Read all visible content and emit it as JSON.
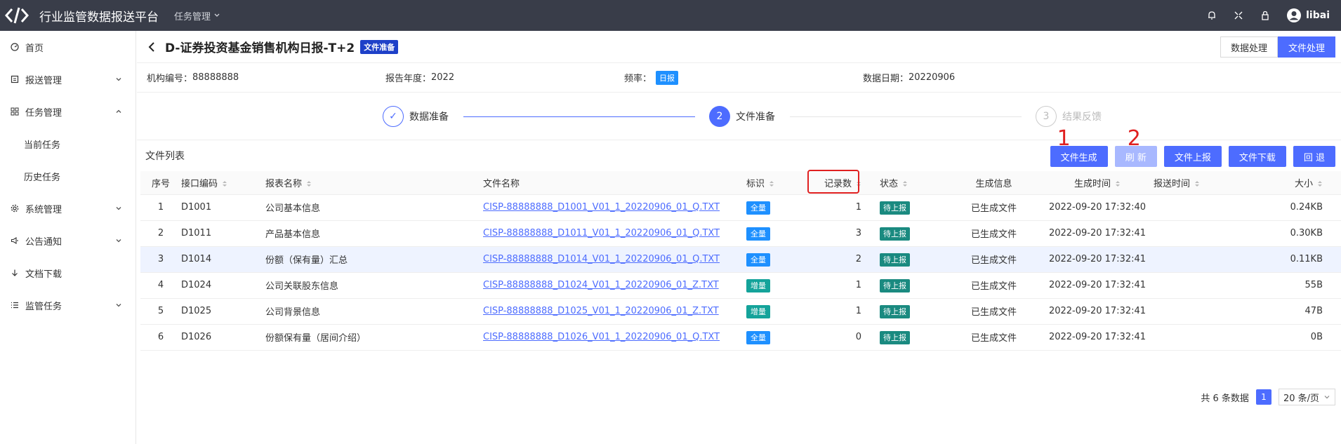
{
  "app": {
    "title": "行业监管数据报送平台",
    "top_menu": "任务管理",
    "user": "libai"
  },
  "sidebar": {
    "items": [
      {
        "label": "首页",
        "icon": "dashboard-icon"
      },
      {
        "label": "报送管理",
        "icon": "report-icon"
      },
      {
        "label": "任务管理",
        "icon": "grid-icon"
      },
      {
        "label": "当前任务"
      },
      {
        "label": "历史任务"
      },
      {
        "label": "系统管理",
        "icon": "gear-icon"
      },
      {
        "label": "公告通知",
        "icon": "megaphone-icon"
      },
      {
        "label": "文档下载",
        "icon": "download-icon"
      },
      {
        "label": "监管任务",
        "icon": "list-icon"
      }
    ]
  },
  "page": {
    "title": "D-证券投资基金销售机构日报-T+2",
    "title_tag": "文件准备",
    "mode_buttons": [
      "数据处理",
      "文件处理"
    ]
  },
  "info": {
    "org_label": "机构编号：",
    "org_value": "88888888",
    "year_label": "报告年度：",
    "year_value": "2022",
    "freq_label": "频率：",
    "freq_value": "日报",
    "date_label": "数据日期：",
    "date_value": "20220906"
  },
  "steps": [
    {
      "num": "✓",
      "label": "数据准备"
    },
    {
      "num": "2",
      "label": "文件准备"
    },
    {
      "num": "3",
      "label": "结果反馈"
    }
  ],
  "list": {
    "title": "文件列表",
    "buttons": [
      "文件生成",
      "刷 新",
      "文件上报",
      "文件下载",
      "回 退"
    ],
    "annotations": [
      "1",
      "2"
    ]
  },
  "table": {
    "headers": [
      "序号",
      "接口编码",
      "报表名称",
      "文件名称",
      "标识",
      "记录数",
      "状态",
      "生成信息",
      "生成时间",
      "报送时间",
      "大小"
    ],
    "rows": [
      [
        "1",
        "D1001",
        "公司基本信息",
        "CISP-88888888_D1001_V01_1_20220906_01_Q.TXT",
        "全量",
        "1",
        "待上报",
        "已生成文件",
        "2022-09-20 17:32:40",
        "",
        "0.24KB"
      ],
      [
        "2",
        "D1011",
        "产品基本信息",
        "CISP-88888888_D1011_V01_1_20220906_01_Q.TXT",
        "全量",
        "3",
        "待上报",
        "已生成文件",
        "2022-09-20 17:32:41",
        "",
        "0.30KB"
      ],
      [
        "3",
        "D1014",
        "份额（保有量）汇总",
        "CISP-88888888_D1014_V01_1_20220906_01_Q.TXT",
        "全量",
        "2",
        "待上报",
        "已生成文件",
        "2022-09-20 17:32:41",
        "",
        "0.11KB"
      ],
      [
        "4",
        "D1024",
        "公司关联股东信息",
        "CISP-88888888_D1024_V01_1_20220906_01_Z.TXT",
        "增量",
        "1",
        "待上报",
        "已生成文件",
        "2022-09-20 17:32:41",
        "",
        "55B"
      ],
      [
        "5",
        "D1025",
        "公司背景信息",
        "CISP-88888888_D1025_V01_1_20220906_01_Z.TXT",
        "增量",
        "1",
        "待上报",
        "已生成文件",
        "2022-09-20 17:32:41",
        "",
        "47B"
      ],
      [
        "6",
        "D1026",
        "份额保有量（居间介绍）",
        "CISP-88888888_D1026_V01_1_20220906_01_Q.TXT",
        "全量",
        "0",
        "待上报",
        "已生成文件",
        "2022-09-20 17:32:41",
        "",
        "0B"
      ]
    ]
  },
  "pager": {
    "total": "共 6 条数据",
    "page": "1",
    "size": "20 条/页"
  }
}
